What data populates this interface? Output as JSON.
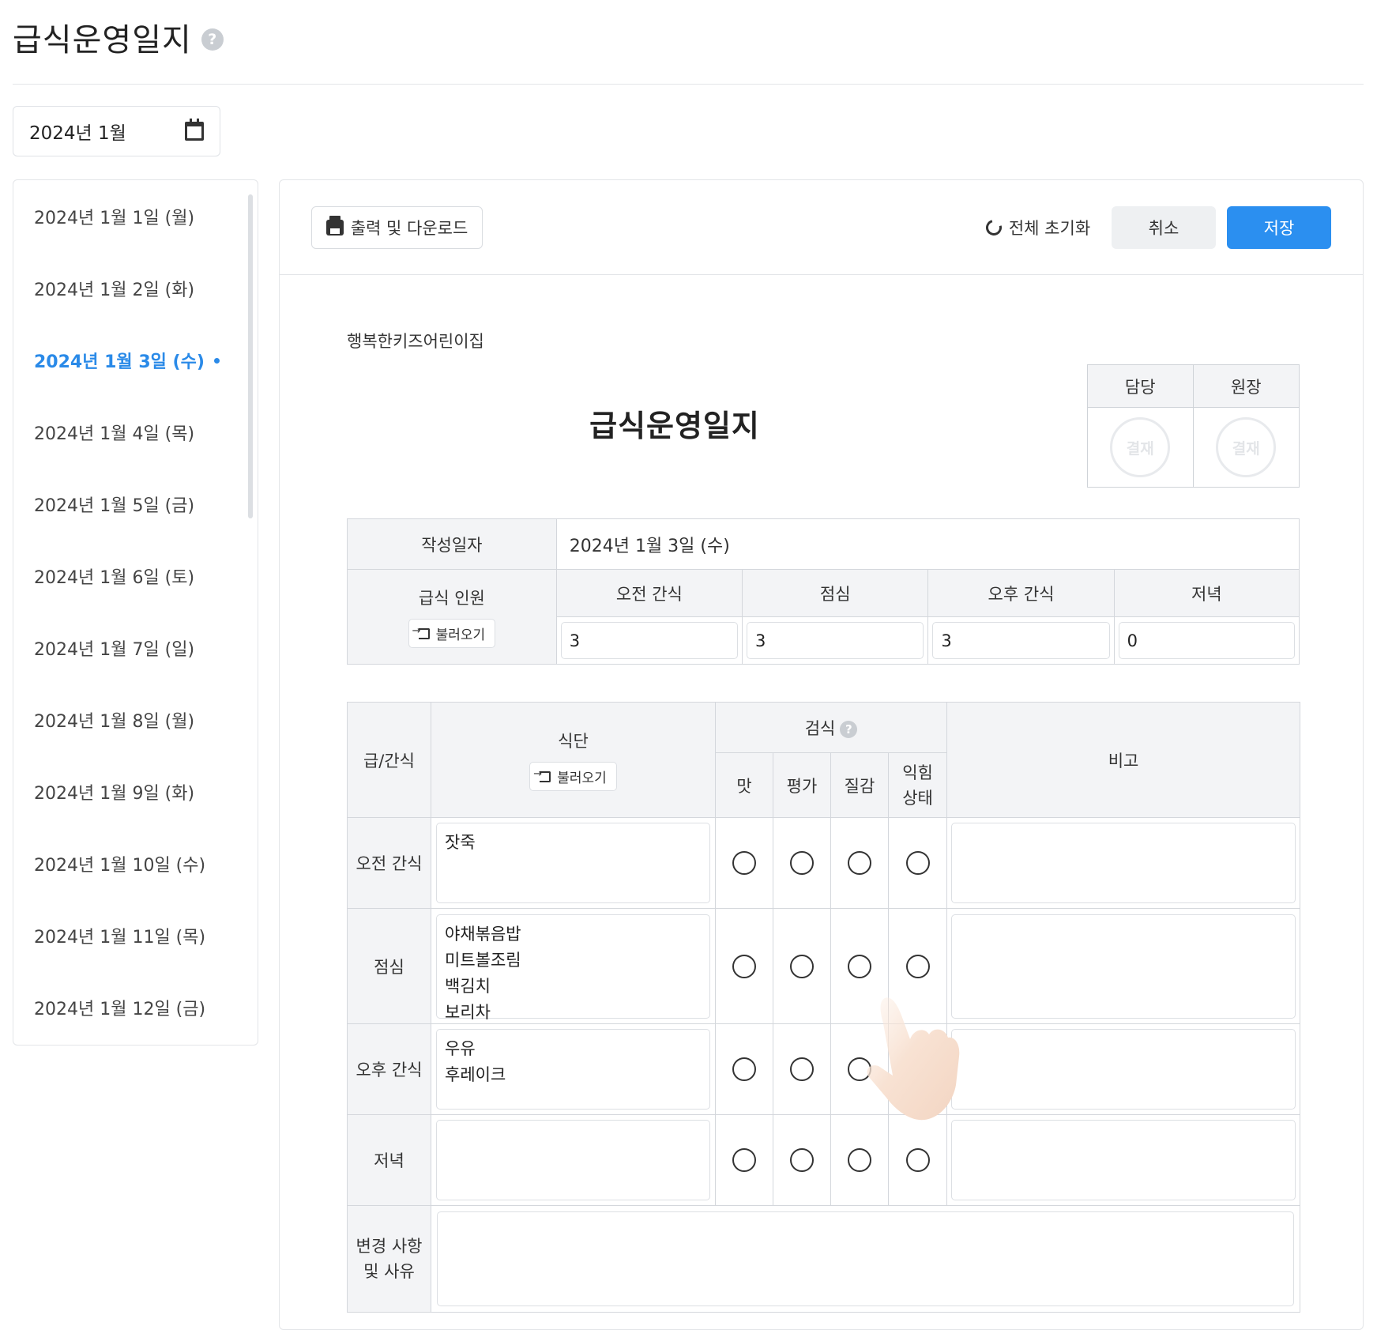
{
  "page": {
    "title": "급식운영일지",
    "help_glyph": "?"
  },
  "month_picker": {
    "value": "2024년 1월"
  },
  "dates": [
    {
      "label": "2024년 1월 1일 (월)",
      "active": false
    },
    {
      "label": "2024년 1월 2일 (화)",
      "active": false
    },
    {
      "label": "2024년 1월 3일 (수)",
      "active": true
    },
    {
      "label": "2024년 1월 4일 (목)",
      "active": false
    },
    {
      "label": "2024년 1월 5일 (금)",
      "active": false
    },
    {
      "label": "2024년 1월 6일 (토)",
      "active": false
    },
    {
      "label": "2024년 1월 7일 (일)",
      "active": false
    },
    {
      "label": "2024년 1월 8일 (월)",
      "active": false
    },
    {
      "label": "2024년 1월 9일 (화)",
      "active": false
    },
    {
      "label": "2024년 1월 10일 (수)",
      "active": false
    },
    {
      "label": "2024년 1월 11일 (목)",
      "active": false
    },
    {
      "label": "2024년 1월 12일 (금)",
      "active": false
    }
  ],
  "toolbar": {
    "print_label": "출력 및 다운로드",
    "reset_label": "전체 초기화",
    "cancel_label": "취소",
    "save_label": "저장",
    "save_color": "#2b8ff0"
  },
  "doc": {
    "org_name": "행복한키즈어린이집",
    "title": "급식운영일지",
    "approval": {
      "heads": [
        "담당",
        "원장"
      ],
      "stamp_label": "결재"
    },
    "info": {
      "date_label": "작성일자",
      "date_value": "2024년 1월 3일 (수)",
      "headcount_label": "급식 인원",
      "load_label": "불러오기",
      "meal_heads": [
        "오전 간식",
        "점심",
        "오후 간식",
        "저녁"
      ],
      "headcounts": [
        "3",
        "3",
        "3",
        "0"
      ]
    },
    "meals": {
      "col_type": "급/간식",
      "col_menu": "식단",
      "load_label": "불러오기",
      "col_check": "검식",
      "check_heads": [
        "맛",
        "평가",
        "질감",
        "익힘 상태"
      ],
      "col_note": "비고",
      "rows": [
        {
          "type": "오전 간식",
          "menu": "잣죽"
        },
        {
          "type": "점심",
          "menu": "야채볶음밥\n미트볼조림\n백김치\n보리차"
        },
        {
          "type": "오후 간식",
          "menu": "우유\n후레이크"
        },
        {
          "type": "저녁",
          "menu": ""
        }
      ],
      "change_label": "변경 사항 및 사유"
    }
  }
}
